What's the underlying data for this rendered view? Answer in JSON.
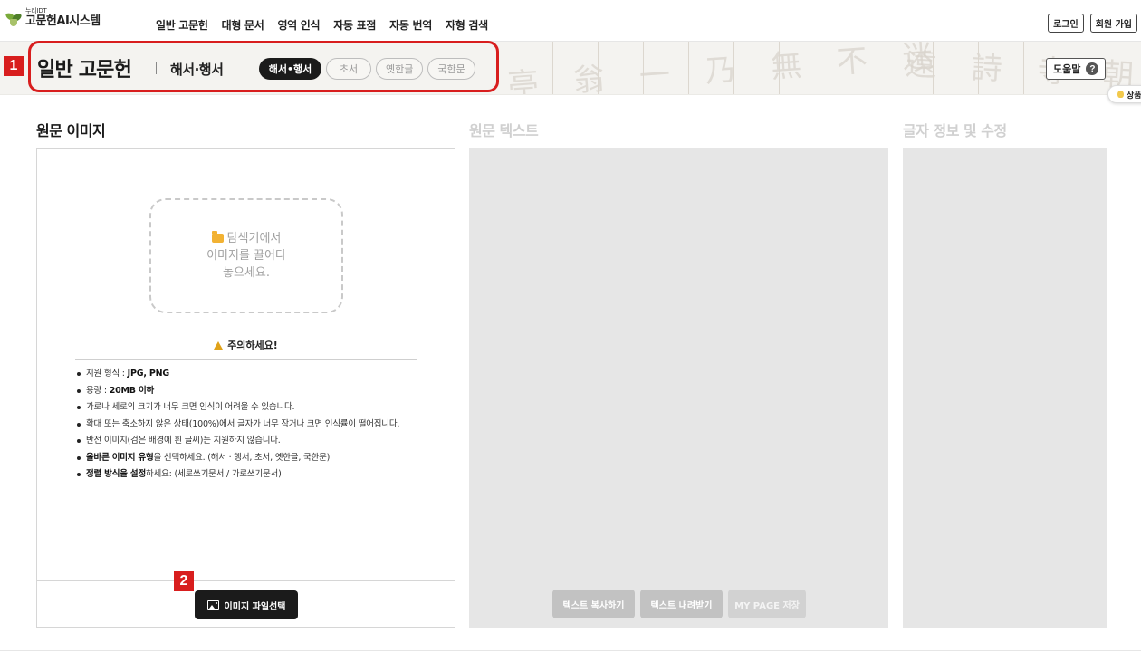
{
  "brand": {
    "sub": "누리IDT",
    "name": "고문헌AI시스템"
  },
  "nav": {
    "items": [
      "일반 고문헌",
      "대형 문서",
      "영역 인식",
      "자동 표점",
      "자동 번역",
      "자형 검색"
    ],
    "login": "로그인",
    "signup": "회원 가입"
  },
  "header": {
    "title": "일반 고문헌",
    "subtitle": "해서·행서",
    "pills": [
      {
        "label": "해서•행서",
        "active": true
      },
      {
        "label": "초서",
        "active": false
      },
      {
        "label": "옛한글",
        "active": false
      },
      {
        "label": "국한문",
        "active": false
      }
    ],
    "help_label": "도움말",
    "help_symbol": "?",
    "side_tab": "상품"
  },
  "annotations": {
    "marker1": "1",
    "marker2": "2",
    "highlight_color": "#d81e1e"
  },
  "columns": {
    "image_title": "원문 이미지",
    "text_title": "원문 텍스트",
    "info_title": "글자 정보 및 수정"
  },
  "dropzone": {
    "line1": "탐색기에서",
    "line2": "이미지를 끌어다",
    "line3": "놓으세요."
  },
  "notice": {
    "title": "주의하세요!",
    "items": [
      {
        "prefix": "지원 형식 : ",
        "bold": "JPG, PNG",
        "suffix": ""
      },
      {
        "prefix": "용량 : ",
        "bold": "20MB 이하",
        "suffix": ""
      },
      {
        "prefix": "가로나 세로의 크기가 너무 크면 인식이 어려울 수 있습니다.",
        "bold": "",
        "suffix": ""
      },
      {
        "prefix": "확대 또는 축소하지 않은 상태(100%)에서 글자가 너무 작거나 크면 인식률이 떨어집니다.",
        "bold": "",
        "suffix": ""
      },
      {
        "prefix": "반전 이미지(검은 배경에 흰 글씨)는 지원하지 않습니다.",
        "bold": "",
        "suffix": ""
      },
      {
        "prefix": "",
        "bold": "올바른 이미지 유형",
        "suffix": "을 선택하세요. (해서 · 행서, 초서, 옛한글, 국한문)"
      },
      {
        "prefix": "",
        "bold": "정렬 방식을 설정",
        "suffix": "하세요: (세로쓰기문서 / 가로쓰기문서)"
      }
    ]
  },
  "buttons": {
    "file_select": "이미지 파일선택",
    "copy_text": "텍스트 복사하기",
    "download_text": "텍스트 내려받기",
    "mypage_save": "MY PAGE 저장"
  },
  "colors": {
    "accent_dark": "#1b1b1b",
    "panel_gray": "#e6e6e6",
    "disabled_btn": "#c2c2c2"
  }
}
